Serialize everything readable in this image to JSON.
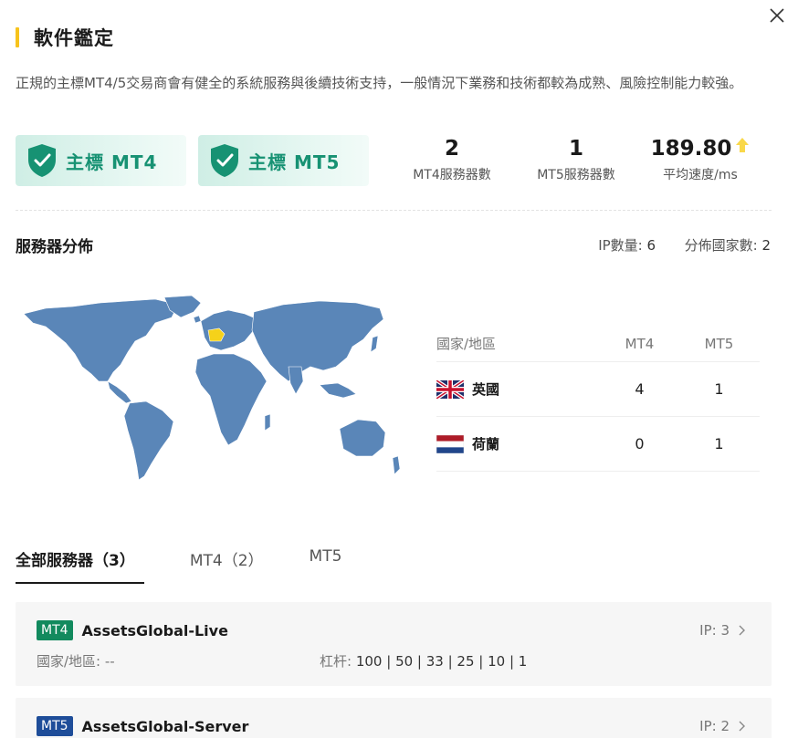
{
  "section": {
    "title": "軟件鑑定"
  },
  "description": "正規的主標MT4/5交易商會有健全的系統服務與後續技術支持，一般情況下業務和技術都較為成熟、風險控制能力較強。",
  "badges": [
    {
      "label": "主標 MT4",
      "icon": "shield-check-icon"
    },
    {
      "label": "主標 MT5",
      "icon": "shield-check-icon"
    }
  ],
  "stats": [
    {
      "value": "2",
      "label": "MT4服務器數"
    },
    {
      "value": "1",
      "label": "MT5服務器數"
    },
    {
      "value": "189.80",
      "label": "平均速度/ms",
      "icon": "arrow-up-icon"
    }
  ],
  "distribution": {
    "title": "服務器分佈",
    "ip_count_label": "IP數量:",
    "ip_count": "6",
    "country_count_label": "分佈國家數:",
    "country_count": "2",
    "table": {
      "headers": [
        "國家/地區",
        "MT4",
        "MT5"
      ],
      "rows": [
        {
          "country": "英國",
          "flag": "uk-flag-icon",
          "mt4": "4",
          "mt5": "1"
        },
        {
          "country": "荷蘭",
          "flag": "netherlands-flag-icon",
          "mt4": "0",
          "mt5": "1"
        }
      ]
    }
  },
  "tabs": [
    {
      "label": "全部服務器（3）",
      "active": true
    },
    {
      "label": "MT4（2）",
      "active": false
    },
    {
      "label": "MT5",
      "active": false
    }
  ],
  "servers": [
    {
      "tag": "MT4",
      "name": "AssetsGlobal-Live",
      "ip_text": "IP: 3",
      "country_label": "國家/地區:",
      "country_value": "--",
      "leverage_label": "杠杆:",
      "leverage_value": "100 | 50 | 33 | 25 | 10 | 1"
    },
    {
      "tag": "MT5",
      "name": "AssetsGlobal-Server",
      "ip_text": "IP: 2"
    }
  ],
  "colors": {
    "accent": "#f7c31c",
    "badge_green": "#179273",
    "map_blue": "#5a86b8",
    "map_highlight": "#f5d21a",
    "tag_mt4": "#128a5e",
    "tag_mt5": "#1e4d99"
  }
}
